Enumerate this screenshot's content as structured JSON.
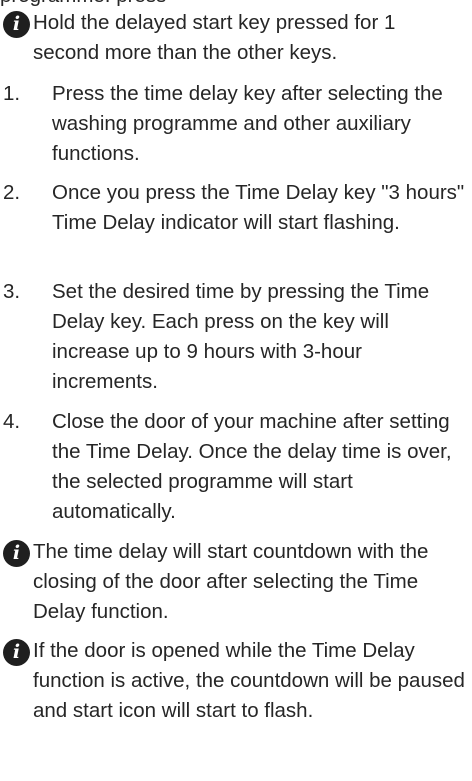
{
  "top_clipped_line": "programme. press",
  "notes": [
    "Hold the delayed start key pressed for 1 second more than the other keys.",
    "The time delay will start countdown with the closing of the door after selecting the Time Delay function.",
    "If the door is opened while the Time Delay function is active, the countdown will be paused and start icon will start to flash."
  ],
  "info_icon_glyph": "i",
  "steps": [
    {
      "number": "1.",
      "text": "Press the time delay key after selecting the washing programme and other auxiliary functions."
    },
    {
      "number": "2.",
      "text": "Once you press the Time Delay key \"3 hours\" Time Delay indicator will start flashing."
    },
    {
      "number": "3.",
      "text": "Set the desired time by pressing the Time Delay key. Each press on the key will increase up to 9 hours with 3-hour increments."
    },
    {
      "number": "4.",
      "text": "Close the door of your machine after setting the Time Delay. Once the delay time is over, the selected programme will start automatically."
    }
  ]
}
